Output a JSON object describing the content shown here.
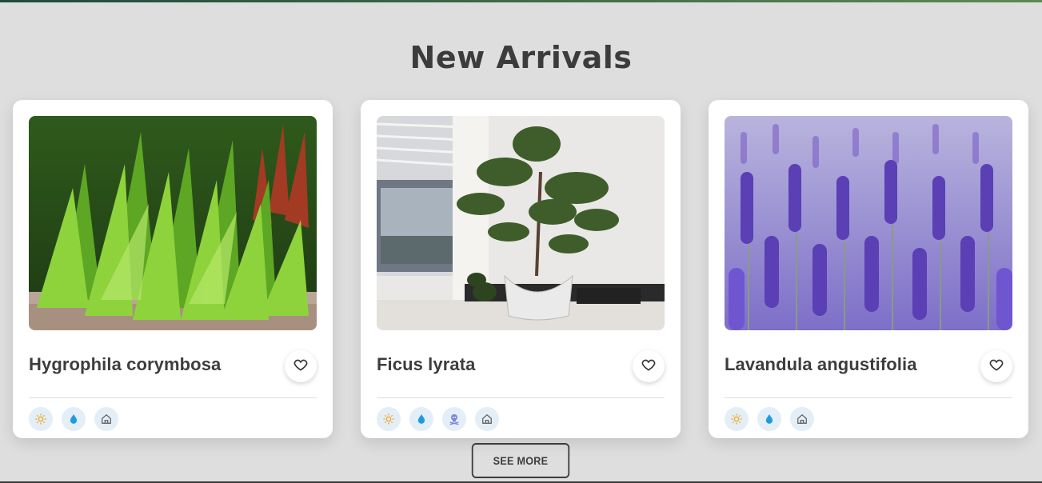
{
  "section": {
    "title": "New Arrivals"
  },
  "cards": [
    {
      "name": "Hygrophila corymbosa",
      "badges": [
        "sun-icon",
        "water-drop-icon",
        "indoor-home-icon"
      ]
    },
    {
      "name": "Ficus lyrata",
      "badges": [
        "sun-icon",
        "water-drop-icon",
        "toxic-skull-icon",
        "indoor-home-icon"
      ]
    },
    {
      "name": "Lavandula angustifolia",
      "badges": [
        "sun-icon",
        "water-drop-icon",
        "indoor-home-icon"
      ]
    }
  ],
  "actions": {
    "see_more_label": "See more"
  },
  "colors": {
    "background": "#dedede",
    "card": "#ffffff",
    "badge_bg": "#e3eef7",
    "sun": "#f2a71b",
    "drop": "#1e9be0",
    "toxic": "#7d84e0"
  }
}
